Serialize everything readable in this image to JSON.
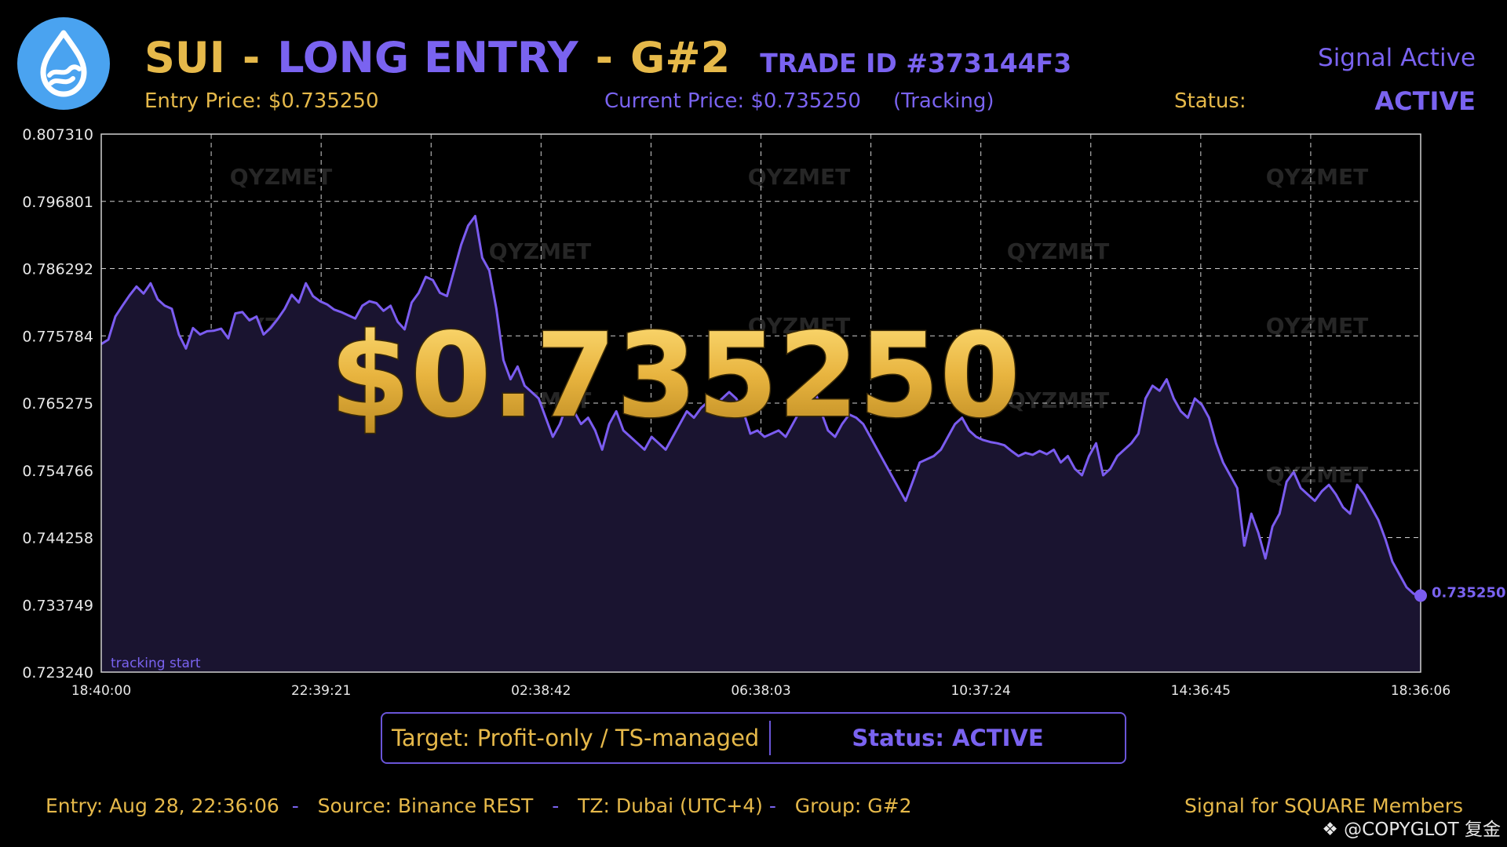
{
  "header": {
    "symbol": "SUI",
    "sep1": "-",
    "entry_type": "LONG ENTRY",
    "sep2": "-",
    "group": "G#2",
    "trade_id": "TRADE ID #373144F3",
    "signal_status": "Signal Active",
    "entry_price": "Entry Price: $0.735250",
    "current_price": "Current Price: $0.735250",
    "tracking": "(Tracking)",
    "status_label": "Status:",
    "status_value": "ACTIVE"
  },
  "big_price": "$0.735250",
  "watermark": "QYZMET",
  "info_box": {
    "target": "Target: Profit-only / TS-managed",
    "status": "Status: ACTIVE"
  },
  "footer": {
    "entry": "Entry: Aug 28, 22:36:06",
    "source": "Source: Binance REST",
    "tz": "TZ: Dubai (UTC+4)",
    "group": "Group: G#2",
    "signal_for": "Signal for SQUARE Members",
    "copyglot": "@COPYGLOT 复金"
  },
  "colors": {
    "gold": "#e6b94a",
    "purple": "#7a63f0",
    "line": "#7b5cf0",
    "logo": "#4aa3f0"
  },
  "icons": {
    "logo": "sui-droplet-icon",
    "copyglot": "diamond-logo-icon"
  },
  "chart_data": {
    "type": "line",
    "ylim": [
      0.72324,
      0.80731
    ],
    "y_ticks": [
      "0.807310",
      "0.796801",
      "0.786292",
      "0.775784",
      "0.765275",
      "0.754766",
      "0.744258",
      "0.733749",
      "0.723240"
    ],
    "x_ticks": [
      "18:40:00",
      "22:39:21",
      "02:38:42",
      "06:38:03",
      "10:37:24",
      "14:36:45",
      "18:36:06"
    ],
    "grid": true,
    "annotation": "tracking start",
    "last_value_label": "0.735250",
    "series": [
      {
        "values": [
          0.7745,
          0.7752,
          0.7788,
          0.7805,
          0.7821,
          0.7835,
          0.7824,
          0.784,
          0.7815,
          0.7805,
          0.78,
          0.776,
          0.7738,
          0.777,
          0.776,
          0.7765,
          0.7766,
          0.7769,
          0.7754,
          0.7793,
          0.7795,
          0.7782,
          0.7788,
          0.776,
          0.777,
          0.7784,
          0.78,
          0.7822,
          0.781,
          0.784,
          0.782,
          0.7812,
          0.7807,
          0.7799,
          0.7795,
          0.779,
          0.7785,
          0.7805,
          0.7812,
          0.7809,
          0.7797,
          0.7805,
          0.778,
          0.7768,
          0.781,
          0.7825,
          0.785,
          0.7845,
          0.7825,
          0.782,
          0.786,
          0.79,
          0.793,
          0.7945,
          0.788,
          0.786,
          0.78,
          0.772,
          0.769,
          0.771,
          0.768,
          0.767,
          0.766,
          0.763,
          0.76,
          0.762,
          0.765,
          0.764,
          0.762,
          0.763,
          0.761,
          0.758,
          0.762,
          0.764,
          0.761,
          0.76,
          0.759,
          0.758,
          0.76,
          0.759,
          0.758,
          0.76,
          0.762,
          0.764,
          0.763,
          0.7645,
          0.7655,
          0.765,
          0.766,
          0.767,
          0.766,
          0.764,
          0.7605,
          0.761,
          0.76,
          0.7605,
          0.761,
          0.76,
          0.762,
          0.764,
          0.766,
          0.768,
          0.764,
          0.761,
          0.76,
          0.762,
          0.7635,
          0.763,
          0.762,
          0.76,
          0.758,
          0.756,
          0.754,
          0.752,
          0.75,
          0.753,
          0.756,
          0.7565,
          0.757,
          0.758,
          0.76,
          0.762,
          0.763,
          0.761,
          0.76,
          0.7595,
          0.7592,
          0.759,
          0.7587,
          0.7578,
          0.757,
          0.7575,
          0.7572,
          0.7578,
          0.7573,
          0.758,
          0.756,
          0.757,
          0.755,
          0.754,
          0.757,
          0.759,
          0.754,
          0.755,
          0.757,
          0.758,
          0.759,
          0.7605,
          0.766,
          0.768,
          0.7672,
          0.769,
          0.766,
          0.764,
          0.763,
          0.766,
          0.765,
          0.763,
          0.759,
          0.756,
          0.754,
          0.752,
          0.743,
          0.748,
          0.745,
          0.741,
          0.746,
          0.748,
          0.753,
          0.7545,
          0.752,
          0.751,
          0.75,
          0.7515,
          0.7525,
          0.751,
          0.749,
          0.748,
          0.7525,
          0.751,
          0.749,
          0.747,
          0.744,
          0.7405,
          0.7385,
          0.7365,
          0.7355,
          0.7352
        ]
      }
    ]
  }
}
